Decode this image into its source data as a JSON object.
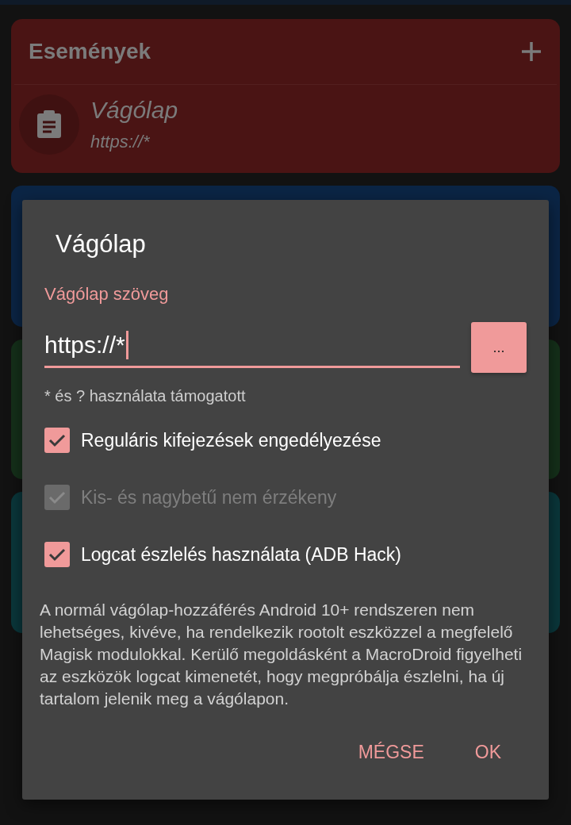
{
  "events_card": {
    "title": "Események",
    "color": "#4a1414",
    "item": {
      "title": "Vágólap",
      "subtitle": "https://*"
    }
  },
  "background_cards": [
    {
      "color": "#0b2545"
    },
    {
      "color": "#15301a"
    },
    {
      "color": "#0a373b"
    }
  ],
  "dialog": {
    "title": "Vágólap",
    "field_label": "Vágólap szöveg",
    "field_value": "https://*",
    "field_focused": true,
    "browse_button": "...",
    "helper": "* és ? használata támogatott",
    "options": [
      {
        "label": "Reguláris kifejezések engedélyezése",
        "checked": true,
        "disabled": false
      },
      {
        "label": "Kis- és nagybetű nem érzékeny",
        "checked": true,
        "disabled": true
      },
      {
        "label": "Logcat észlelés használata (ADB Hack)",
        "checked": true,
        "disabled": false
      }
    ],
    "description": "A normál vágólap-hozzáférés Android 10+ rendszeren nem lehetséges, kivéve, ha rendelkezik rootolt eszközzel a megfelelő Magisk modulokkal. Kerülő megoldásként a MacroDroid figyelheti az eszközök logcat kimenetét, hogy megpróbálja észlelni, ha új tartalom jelenik meg a vágólapon.",
    "buttons": [
      "MÉGSE",
      "OK"
    ]
  }
}
